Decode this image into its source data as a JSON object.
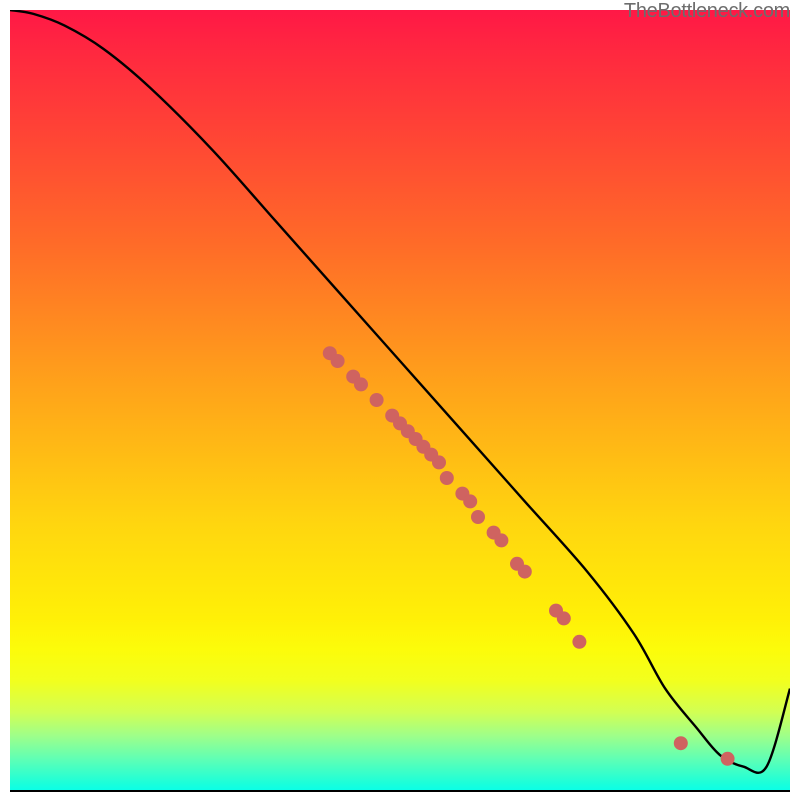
{
  "attribution": "TheBottleneck.com",
  "chart_data": {
    "type": "line",
    "title": "",
    "xlabel": "",
    "ylabel": "",
    "xlim": [
      0,
      100
    ],
    "ylim": [
      0,
      100
    ],
    "background_gradient_stops": [
      {
        "pos": 0,
        "hex": "#ff1846"
      },
      {
        "pos": 5,
        "hex": "#ff2740"
      },
      {
        "pos": 17,
        "hex": "#ff4734"
      },
      {
        "pos": 30,
        "hex": "#ff6b28"
      },
      {
        "pos": 48,
        "hex": "#ffa21a"
      },
      {
        "pos": 66,
        "hex": "#ffd60f"
      },
      {
        "pos": 78,
        "hex": "#fff007"
      },
      {
        "pos": 82,
        "hex": "#fcfc0a"
      },
      {
        "pos": 86,
        "hex": "#f2ff1e"
      },
      {
        "pos": 90,
        "hex": "#d2ff53"
      },
      {
        "pos": 93,
        "hex": "#9fff89"
      },
      {
        "pos": 96,
        "hex": "#60ffb4"
      },
      {
        "pos": 99,
        "hex": "#1effd8"
      },
      {
        "pos": 100,
        "hex": "#0bffe6"
      }
    ],
    "series": [
      {
        "name": "bottleneck-curve",
        "x": [
          0,
          3,
          7,
          12,
          18,
          26,
          34,
          42,
          50,
          58,
          66,
          74,
          80,
          84,
          88,
          91,
          94,
          97,
          100
        ],
        "values": [
          100,
          99.5,
          98,
          95,
          90,
          82,
          73,
          64,
          55,
          46,
          37,
          28,
          20,
          13,
          8,
          4.5,
          3,
          3,
          13
        ]
      }
    ],
    "scatter_overlay": {
      "name": "curve-points",
      "color": "#cf6360",
      "points": [
        {
          "x": 41,
          "y": 56
        },
        {
          "x": 42,
          "y": 55
        },
        {
          "x": 44,
          "y": 53
        },
        {
          "x": 45,
          "y": 52
        },
        {
          "x": 47,
          "y": 50
        },
        {
          "x": 49,
          "y": 48
        },
        {
          "x": 50,
          "y": 47
        },
        {
          "x": 51,
          "y": 46
        },
        {
          "x": 52,
          "y": 45
        },
        {
          "x": 53,
          "y": 44
        },
        {
          "x": 54,
          "y": 43
        },
        {
          "x": 55,
          "y": 42
        },
        {
          "x": 56,
          "y": 40
        },
        {
          "x": 58,
          "y": 38
        },
        {
          "x": 59,
          "y": 37
        },
        {
          "x": 60,
          "y": 35
        },
        {
          "x": 62,
          "y": 33
        },
        {
          "x": 63,
          "y": 32
        },
        {
          "x": 65,
          "y": 29
        },
        {
          "x": 66,
          "y": 28
        },
        {
          "x": 70,
          "y": 23
        },
        {
          "x": 71,
          "y": 22
        },
        {
          "x": 73,
          "y": 19
        },
        {
          "x": 86,
          "y": 6
        },
        {
          "x": 92,
          "y": 4
        }
      ]
    }
  }
}
